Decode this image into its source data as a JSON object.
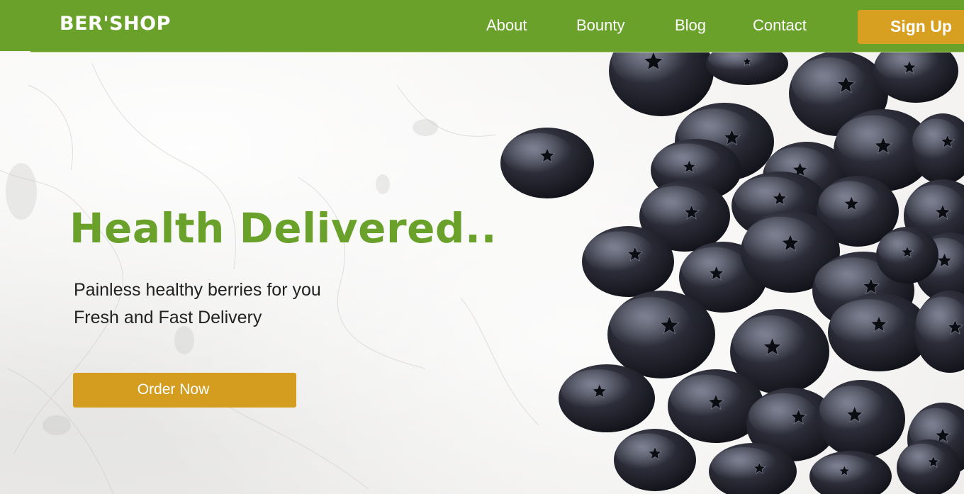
{
  "brand": {
    "logo_text": "BER'SHOP",
    "nav_color": "#6aa12b",
    "accent_color": "#d8a020",
    "title_color": "#6aa12b"
  },
  "nav": {
    "links": [
      {
        "label": "About"
      },
      {
        "label": "Bounty"
      },
      {
        "label": "Blog"
      },
      {
        "label": "Contact"
      }
    ],
    "signup_label": "Sign Up"
  },
  "hero": {
    "title": "Health Delivered..",
    "subtitle_line1": "Painless healthy berries for you",
    "subtitle_line2": "Fresh and Fast Delivery",
    "cta_label": "Order Now",
    "image": "blueberries-on-marble"
  }
}
